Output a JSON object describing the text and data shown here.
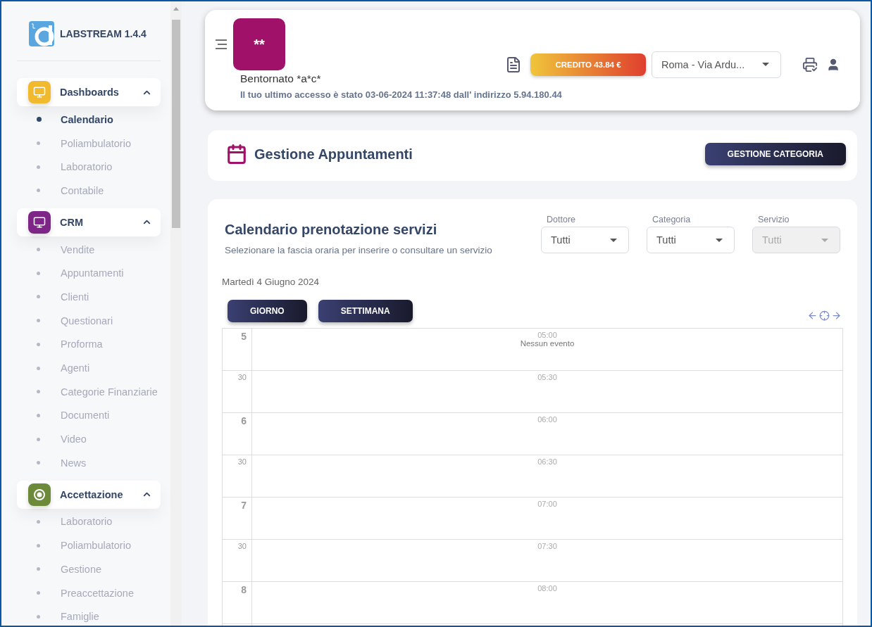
{
  "app": {
    "name": "LABSTREAM 1.4.4"
  },
  "sidebar": {
    "groups": [
      {
        "label": "Dashboards",
        "color": "#f0b92e",
        "expanded": true,
        "children": [
          {
            "label": "Calendario",
            "selected": true
          },
          {
            "label": "Poliambulatorio",
            "selected": false
          },
          {
            "label": "Laboratorio",
            "selected": false
          },
          {
            "label": "Contabile",
            "selected": false
          }
        ]
      },
      {
        "label": "CRM",
        "color": "#7e2588",
        "expanded": true,
        "children": [
          {
            "label": "Vendite",
            "selected": false
          },
          {
            "label": "Appuntamenti",
            "selected": false
          },
          {
            "label": "Clienti",
            "selected": false
          },
          {
            "label": "Questionari",
            "selected": false
          },
          {
            "label": "Proforma",
            "selected": false
          },
          {
            "label": "Agenti",
            "selected": false
          },
          {
            "label": "Categorie Finanziarie",
            "selected": false
          },
          {
            "label": "Documenti",
            "selected": false
          },
          {
            "label": "Video",
            "selected": false
          },
          {
            "label": "News",
            "selected": false
          }
        ]
      },
      {
        "label": "Accettazione",
        "color": "#6c8a3a",
        "expanded": true,
        "children": [
          {
            "label": "Laboratorio",
            "selected": false
          },
          {
            "label": "Poliambulatorio",
            "selected": false
          },
          {
            "label": "Gestione",
            "selected": false
          },
          {
            "label": "Preaccettazione",
            "selected": false
          },
          {
            "label": "Famiglie",
            "selected": false
          }
        ]
      }
    ]
  },
  "header": {
    "avatar_text": "**",
    "greeting": "Bentornato *a*c*",
    "last_access": "Il tuo ultimo accesso è stato 03-06-2024 11:37:48 dall' indirizzo 5.94.180.44",
    "credit_button": "CREDITO 43.84 €",
    "location_select": {
      "value": "Roma - Via Ardu..."
    }
  },
  "page_title_card": {
    "title": "Gestione Appuntamenti",
    "button": "GESTIONE CATEGORIA"
  },
  "calendar_card": {
    "title": "Calendario prenotazione servizi",
    "subtitle": "Selezionare la fascia oraria per inserire o consultare un servizio",
    "filters": [
      {
        "label": "Dottore",
        "value": "Tutti",
        "disabled": false
      },
      {
        "label": "Categoria",
        "value": "Tutti",
        "disabled": false
      },
      {
        "label": "Servizio",
        "value": "Tutti",
        "disabled": true
      }
    ],
    "date": "Martedì 4 Giugno 2024",
    "view_buttons": [
      "GIORNO",
      "SETTIMANA"
    ],
    "slots": [
      {
        "kind": "hour",
        "hour_label": "5",
        "time": "05:00",
        "note": "Nessun evento"
      },
      {
        "kind": "half",
        "hour_label": "30",
        "time": "05:30"
      },
      {
        "kind": "hour",
        "hour_label": "6",
        "time": "06:00"
      },
      {
        "kind": "half",
        "hour_label": "30",
        "time": "06:30"
      },
      {
        "kind": "hour",
        "hour_label": "7",
        "time": "07:00"
      },
      {
        "kind": "half",
        "hour_label": "30",
        "time": "07:30"
      },
      {
        "kind": "hour",
        "hour_label": "8",
        "time": "08:00"
      }
    ]
  }
}
